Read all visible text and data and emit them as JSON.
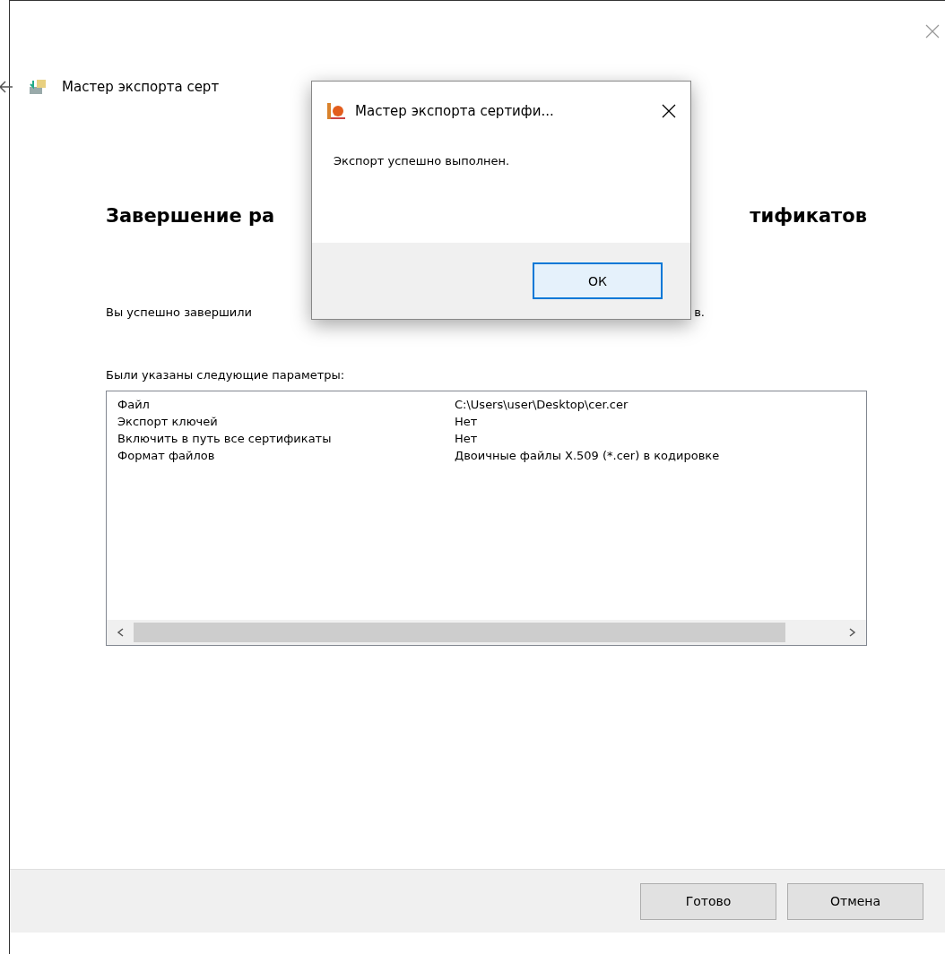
{
  "wizard": {
    "title": "Мастер экспорта серт",
    "heading_left": "Завершение ра",
    "heading_right": "тификатов",
    "intro_left": "Вы успешно завершили",
    "intro_right": "в.",
    "params_label": "Были указаны следующие параметры:",
    "params": [
      {
        "name": "Файл",
        "value": "C:\\Users\\user\\Desktop\\cer.cer"
      },
      {
        "name": "Экспорт ключей",
        "value": "Нет"
      },
      {
        "name": "Включить в путь все сертификаты",
        "value": "Нет"
      },
      {
        "name": "Формат файлов",
        "value": "Двоичные файлы X.509 (*.cer) в кодировке"
      }
    ],
    "buttons": [
      "Готово",
      "Отмена"
    ]
  },
  "dialog": {
    "title": "Мастер экспорта сертифи...",
    "message": "Экспорт успешно выполнен.",
    "button": "ОК",
    "button_focused": true
  }
}
